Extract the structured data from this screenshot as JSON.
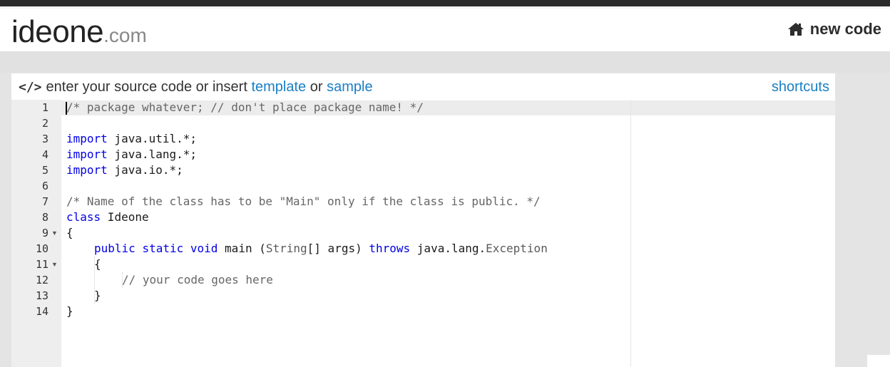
{
  "header": {
    "logo_main": "ideone",
    "logo_tld": ".com",
    "new_code_label": "new code"
  },
  "panel": {
    "prompt_prefix": "enter your source code or insert",
    "template_link": "template",
    "or_text": "or",
    "sample_link": "sample",
    "shortcuts_link": "shortcuts"
  },
  "editor": {
    "line_numbers": [
      "1",
      "2",
      "3",
      "4",
      "5",
      "6",
      "7",
      "8",
      "9",
      "10",
      "11",
      "12",
      "13",
      "14"
    ],
    "lines": {
      "l1": "/* package whatever; // don't place package name! */",
      "l3_kw": "import",
      "l3_rest": " java.util.*;",
      "l4_kw": "import",
      "l4_rest": " java.lang.*;",
      "l5_kw": "import",
      "l5_rest": " java.io.*;",
      "l7": "/* Name of the class has to be \"Main\" only if the class is public. */",
      "l8_kw": "class",
      "l8_rest": " Ideone",
      "l9": "{",
      "l10_kw1": "public",
      "l10_kw2": "static",
      "l10_kw3": "void",
      "l10_main": "main",
      "l10_args_open": "(",
      "l10_string": "String",
      "l10_args_rest": "[] args)",
      "l10_throws": "throws",
      "l10_java": "java.lang.",
      "l10_exception": "Exception",
      "l11": "{",
      "l12": "// your code goes here",
      "l13": "}",
      "l14": "}"
    }
  }
}
